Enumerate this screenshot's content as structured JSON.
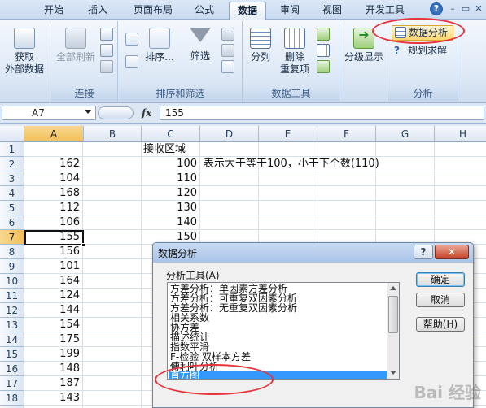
{
  "tabs": [
    "开始",
    "插入",
    "页面布局",
    "公式",
    "数据",
    "审阅",
    "视图",
    "开发工具"
  ],
  "active_tab": "数据",
  "window_controls": {
    "help": "?",
    "minimize": "–",
    "restore": "▭",
    "close": "✕"
  },
  "ribbon": {
    "get_external": {
      "line1": "获取",
      "line2": "外部数据"
    },
    "connections": {
      "refresh_all": "全部刷新",
      "label": "连接"
    },
    "sort_filter": {
      "sort": "排序...",
      "filter": "筛选",
      "label": "排序和筛选"
    },
    "data_tools": {
      "split": "分列",
      "remove": "删除",
      "remove2": "重复项",
      "label": "数据工具"
    },
    "outline": {
      "button": "分级显示"
    },
    "analysis": {
      "data_analysis": "数据分析",
      "solver": "规划求解",
      "label": "分析"
    }
  },
  "formula_bar": {
    "name_box": "A7",
    "fx": "fx",
    "value": "155"
  },
  "columns": [
    "A",
    "B",
    "C",
    "D",
    "E",
    "F",
    "G",
    "H"
  ],
  "selected_column": "A",
  "rows": [
    "1",
    "2",
    "3",
    "4",
    "5",
    "6",
    "7",
    "8",
    "9",
    "10",
    "11",
    "12",
    "13",
    "14",
    "15",
    "16",
    "17",
    "18",
    "19"
  ],
  "selected_row": "7",
  "col_a": [
    "",
    "162",
    "104",
    "168",
    "112",
    "106",
    "155",
    "156",
    "101",
    "164",
    "124",
    "144",
    "154",
    "175",
    "199",
    "148",
    "187",
    "143"
  ],
  "col_c": [
    "接收区域",
    "100",
    "110",
    "120",
    "130",
    "140",
    "150"
  ],
  "note_d2": "表示大于等于100，小于下个数(110)",
  "dialog": {
    "title": "数据分析",
    "help": "?",
    "close": "✕",
    "list_label": "分析工具(A)",
    "tools": [
      "方差分析：单因素方差分析",
      "方差分析：可重复双因素分析",
      "方差分析：无重复双因素分析",
      "相关系数",
      "协方差",
      "描述统计",
      "指数平滑",
      "F-检验 双样本方差",
      "傅利叶分析",
      "直方图"
    ],
    "selected_tool": "直方图",
    "buttons": {
      "ok": "确定",
      "cancel": "取消",
      "help": "帮助(H)"
    }
  },
  "watermark": "Bai 经验",
  "colors": {
    "accent": "#3399ff",
    "highlight_ring": "#e8333a",
    "ribbon": "#dde8f6",
    "selection_header": "#f1be5a"
  }
}
